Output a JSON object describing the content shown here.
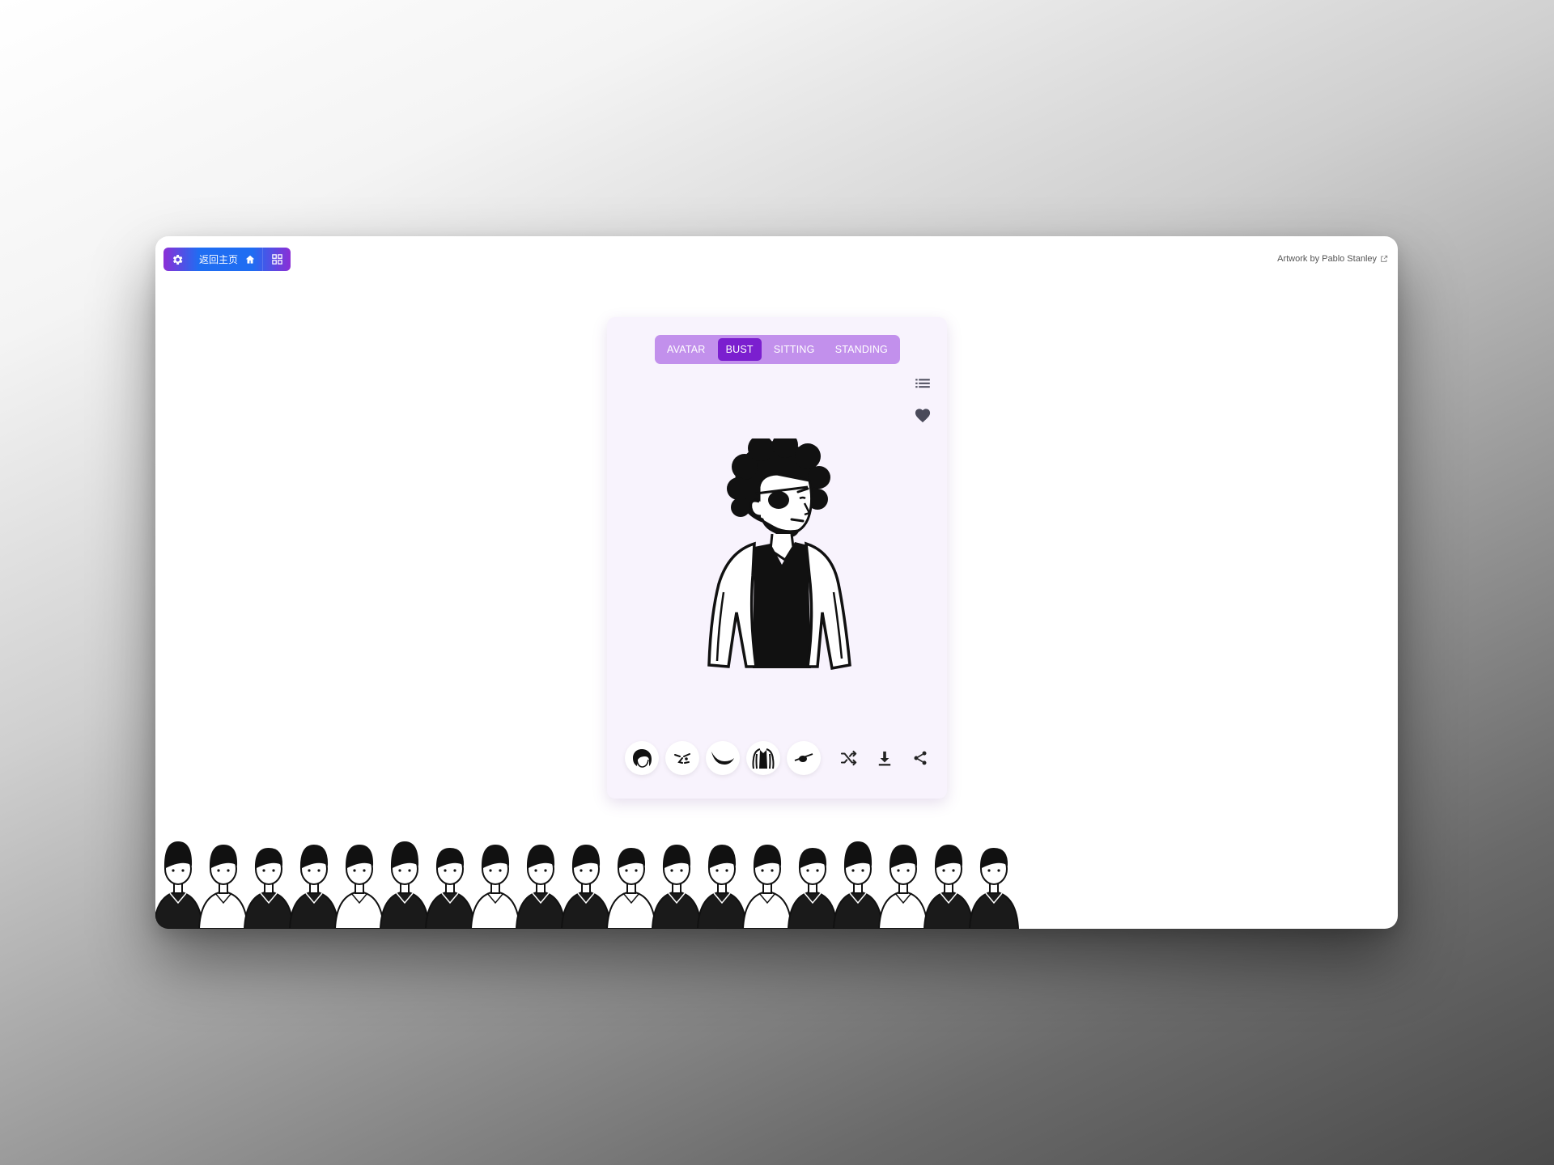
{
  "toolbar": {
    "home_label": "返回主页",
    "settings_icon": "gear-icon",
    "home_icon": "home-icon",
    "apps_icon": "grid-icon"
  },
  "credit": {
    "text": "Artwork by Pablo Stanley",
    "icon": "external-link-icon"
  },
  "tabs": [
    {
      "label": "AVATAR",
      "active": false
    },
    {
      "label": "BUST",
      "active": true
    },
    {
      "label": "SITTING",
      "active": false
    },
    {
      "label": "STANDING",
      "active": false
    }
  ],
  "side_icons": [
    "list-icon",
    "heart-icon"
  ],
  "parts": [
    "hair-part-icon",
    "face-part-icon",
    "facial-hair-part-icon",
    "body-part-icon",
    "accessory-part-icon"
  ],
  "actions": [
    "shuffle-icon",
    "download-icon",
    "share-icon"
  ],
  "colors": {
    "accent": "#7b1fcf",
    "tabs_bg": "#c290ec",
    "card_bg": "#f8f3fd",
    "icon": "#333333"
  }
}
